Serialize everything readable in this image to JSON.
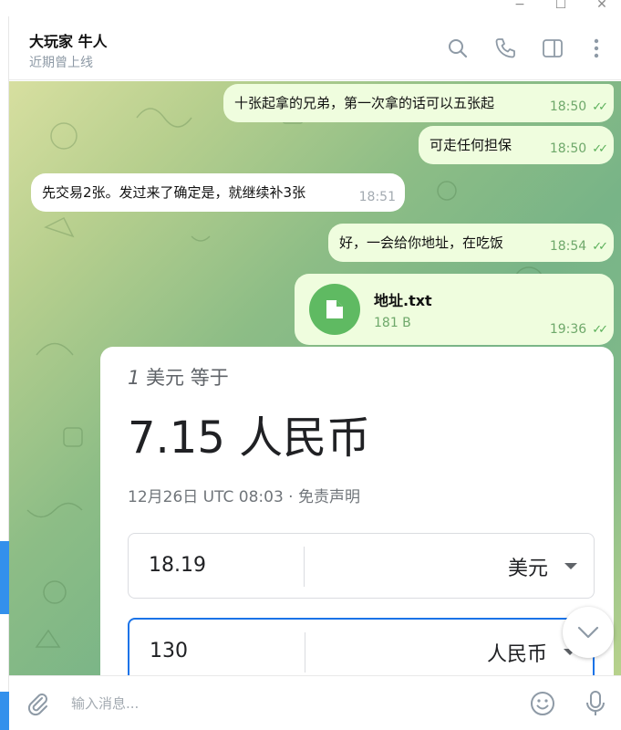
{
  "window": {
    "min_glyph": "−",
    "max_glyph": "☐",
    "close_glyph": "✕"
  },
  "header": {
    "title": "大玩家 牛人",
    "status": "近期曾上线",
    "icons": [
      "search-icon",
      "phone-icon",
      "sidebar-toggle-icon",
      "more-vertical-icon"
    ]
  },
  "messages": [
    {
      "text": "十张起拿的兄弟，第一次拿的话可以五张起",
      "time": "18:50",
      "direction": "out",
      "read": true
    },
    {
      "text": "可走任何担保",
      "time": "18:50",
      "direction": "out",
      "read": true
    },
    {
      "text": "先交易2张。发过来了确定是，就继续补3张",
      "time": "18:51",
      "direction": "in",
      "read": false
    },
    {
      "text": "好，一会给你地址，在吃饭",
      "time": "18:54",
      "direction": "out",
      "read": true
    }
  ],
  "file_message": {
    "name": "地址.txt",
    "size": "181 B",
    "time": "19:36",
    "icon": "file-icon",
    "read": true
  },
  "currency_card": {
    "subtitle_prefix": "1",
    "subtitle_rest": " 美元 等于",
    "result": "7.15 人民币",
    "date_note": "12月26日 UTC 08:03 · 免责声明",
    "from": {
      "value": "18.19",
      "currency": "美元"
    },
    "to": {
      "value": "130",
      "currency": "人民币"
    }
  },
  "composer": {
    "placeholder": "输入消息..."
  },
  "colors": {
    "out_bubble": "#effdde",
    "in_bubble": "#ffffff",
    "accent": "#3390ec",
    "check": "#5bb05a",
    "file_icon_bg": "#5fba62"
  }
}
